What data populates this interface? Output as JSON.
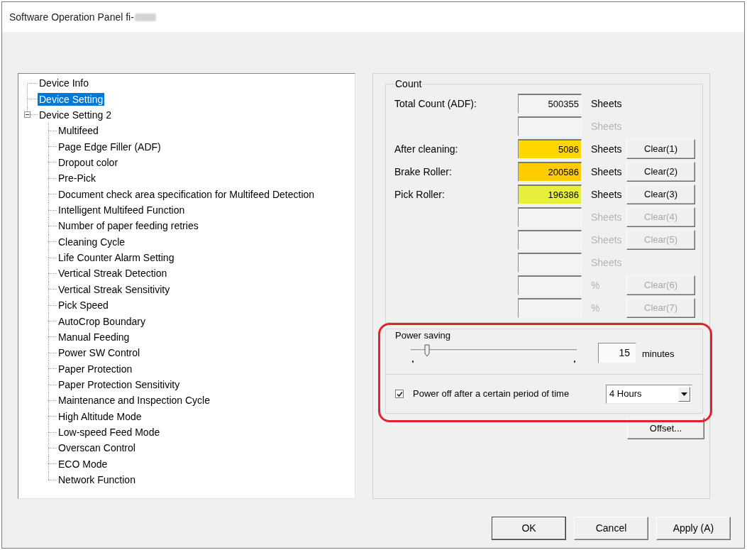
{
  "window": {
    "title": "Software Operation Panel fi-"
  },
  "tree": {
    "items": [
      {
        "label": "Device Info",
        "selected": false
      },
      {
        "label": "Device Setting",
        "selected": true
      },
      {
        "label": "Device Setting 2",
        "selected": false,
        "expanded": true,
        "children": [
          {
            "label": "Multifeed",
            "selected": false
          },
          {
            "label": "Page Edge Filler (ADF)",
            "selected": false
          },
          {
            "label": "Dropout color",
            "selected": false
          },
          {
            "label": "Pre-Pick",
            "selected": false
          },
          {
            "label": "Document check area specification for Multifeed Detection",
            "selected": false
          },
          {
            "label": "Intelligent Multifeed Function",
            "selected": false
          },
          {
            "label": "Number of paper feeding retries",
            "selected": false
          },
          {
            "label": "Cleaning Cycle",
            "selected": false
          },
          {
            "label": "Life Counter Alarm Setting",
            "selected": false
          },
          {
            "label": "Vertical Streak Detection",
            "selected": false
          },
          {
            "label": "Vertical Streak Sensitivity",
            "selected": false
          },
          {
            "label": "Pick Speed",
            "selected": false
          },
          {
            "label": "AutoCrop Boundary",
            "selected": false
          },
          {
            "label": "Manual Feeding",
            "selected": false
          },
          {
            "label": "Power SW Control",
            "selected": false
          },
          {
            "label": "Paper Protection",
            "selected": false
          },
          {
            "label": "Paper Protection Sensitivity",
            "selected": false
          },
          {
            "label": "Maintenance and Inspection Cycle",
            "selected": false
          },
          {
            "label": "High Altitude Mode",
            "selected": false
          },
          {
            "label": "Low-speed Feed Mode",
            "selected": false
          },
          {
            "label": "Overscan Control",
            "selected": false
          },
          {
            "label": "ECO Mode",
            "selected": false
          },
          {
            "label": "Network Function",
            "selected": false
          }
        ]
      }
    ]
  },
  "count": {
    "title": "Count",
    "rows": [
      {
        "label": "Total Count (ADF):",
        "value": "500355",
        "unit": {
          "text": "Sheets",
          "disabled": false
        }
      },
      {
        "unit": {
          "text": "Sheets",
          "disabled": true
        }
      },
      {
        "label": "After cleaning:",
        "value": "5086",
        "color": "#ffd700",
        "unit": {
          "text": "Sheets",
          "disabled": false
        },
        "clear_button": {
          "label": "Clear(1)",
          "disabled": false
        }
      },
      {
        "label": "Brake Roller:",
        "value": "200586",
        "color": "#ffcc00",
        "unit": {
          "text": "Sheets",
          "disabled": false
        },
        "clear_button": {
          "label": "Clear(2)",
          "disabled": false
        }
      },
      {
        "label": "Pick Roller:",
        "value": "196386",
        "color": "#e6f03c",
        "unit": {
          "text": "Sheets",
          "disabled": false
        },
        "clear_button": {
          "label": "Clear(3)",
          "disabled": false
        }
      },
      {
        "unit": {
          "text": "Sheets",
          "disabled": true
        },
        "clear_button": {
          "label": "Clear(4)",
          "disabled": true
        }
      },
      {
        "unit": {
          "text": "Sheets",
          "disabled": true
        },
        "clear_button": {
          "label": "Clear(5)",
          "disabled": true
        }
      },
      {
        "unit": {
          "text": "Sheets",
          "disabled": true
        }
      },
      {
        "unit": {
          "text": "%",
          "disabled": true
        },
        "clear_button": {
          "label": "Clear(6)",
          "disabled": true
        }
      },
      {
        "unit": {
          "text": "%",
          "disabled": true
        },
        "clear_button": {
          "label": "Clear(7)",
          "disabled": true
        }
      }
    ]
  },
  "power_saving": {
    "title": "Power saving",
    "highlighted": true,
    "slider": {
      "level": 0.1
    },
    "minutes": {
      "value": "15",
      "unit": "minutes"
    },
    "power_off": {
      "label": "Power off after a certain period of time",
      "checked": true
    },
    "period": {
      "value": "4 Hours"
    }
  },
  "offset_button": {
    "label": "Offset..."
  },
  "buttons": [
    {
      "label": "OK",
      "default": true
    },
    {
      "label": "Cancel",
      "default": false
    },
    {
      "label": "Apply (A)",
      "default": false
    }
  ]
}
